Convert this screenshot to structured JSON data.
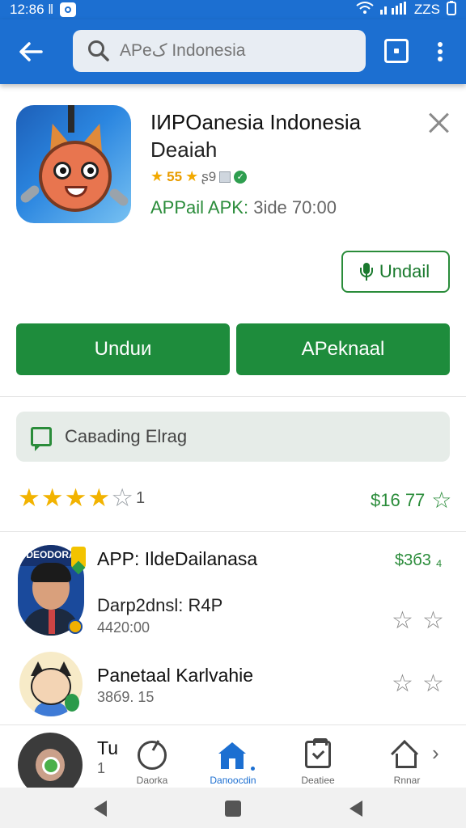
{
  "status_bar": {
    "time": "12:86 ‖",
    "battery": "ZZS"
  },
  "toolbar": {
    "search_placeholder": "APeک Indonesia"
  },
  "app": {
    "title": "IИPOanesia Indonesia",
    "subtitle": "Deaiah",
    "rating_text": "55",
    "rating_extra": "ʂ9",
    "apk_label": "APPail APK:",
    "apk_value": "3ide 70:00",
    "mic_button": "Undail",
    "download_button": "Unduи",
    "install_button": "APeknaal"
  },
  "loading": {
    "label": "Caвading Elrag"
  },
  "summary": {
    "stars_filled": 4,
    "stars_total": 5,
    "count": "1",
    "price": "$16 77"
  },
  "list": [
    {
      "title": "APP: IldeDailanasa",
      "subtitle": "Darp2dnsl: R4P",
      "meta": "4420:00",
      "price": "$3б3 ₄",
      "avatar_banner": "DEODORA"
    },
    {
      "title": "Panetaal Karlvahie",
      "meta": "38б9. 15"
    },
    {
      "title": "Tu",
      "meta": "1"
    }
  ],
  "bottom_nav": [
    {
      "label": "Daorka"
    },
    {
      "label": "Daпoocdin"
    },
    {
      "label": "Deatiee"
    },
    {
      "label": "Rnnar"
    }
  ],
  "colors": {
    "primary_blue": "#1c6fd1",
    "primary_green": "#1e8c3c",
    "star_gold": "#f2b300"
  }
}
